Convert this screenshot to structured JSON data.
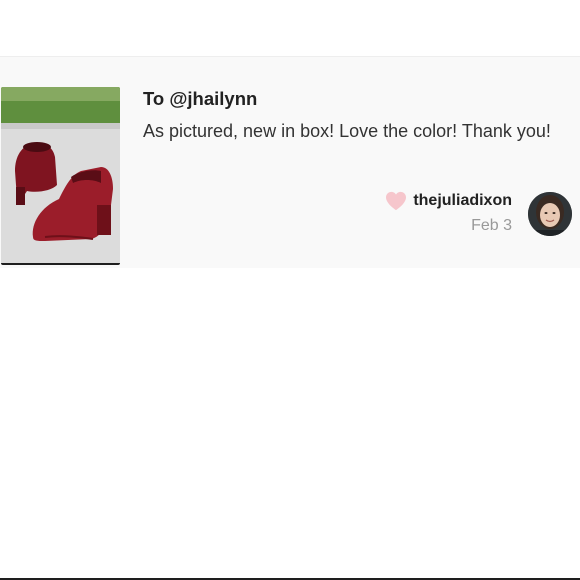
{
  "message": {
    "recipient": "To @jhailynn",
    "text": "As pictured, new in box! Love the color! Thank you!",
    "author": "thejuliadixon",
    "date": "Feb 3"
  },
  "icons": {
    "like": "heart-icon",
    "image": "boots-photo",
    "avatar": "user-avatar"
  },
  "colors": {
    "heart": "#f6c6cc",
    "boot": "#9b1d2a",
    "meta_gray": "#999999"
  }
}
